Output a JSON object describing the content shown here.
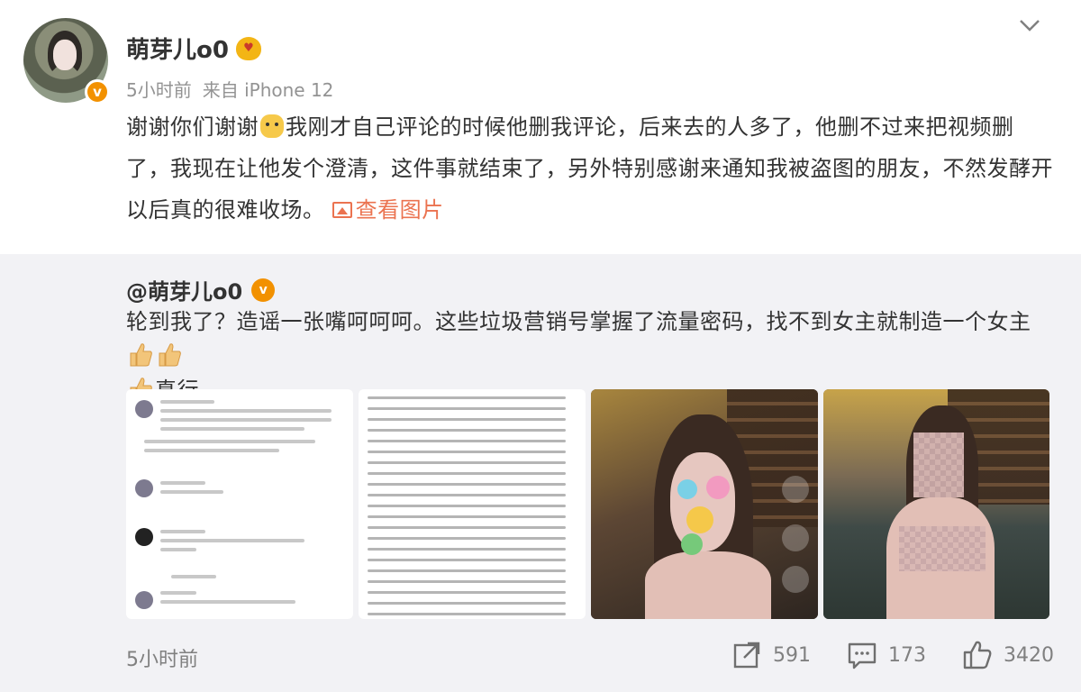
{
  "author": {
    "name": "萌芽儿o0",
    "level_badge_icon": "heart-face-badge-icon",
    "verified_icon": "verified-v-icon"
  },
  "meta": {
    "time": "5小时前",
    "source": "来自 iPhone 12"
  },
  "post": {
    "text_part1": "谢谢你们谢谢",
    "emoji": "dog-face-emoji-icon",
    "text_part2": "我刚才自己评论的时候他删我评论，后来去的人多了，他删不过来把视频删了，我现在让他发个澄清，这件事就结束了，另外特别感谢来通知我被盗图的朋友，不然发酵开以后真的很难收场。",
    "view_images_label": "查看图片"
  },
  "repost": {
    "author": "@萌芽儿o0",
    "text_part1": "轮到我了？造谣一张嘴呵呵呵。这些垃圾营销号掌握了流量密码，找不到女主就制造一个女主",
    "text_part2": "真行。",
    "thumb_icon": "thumbs-up-emoji-icon"
  },
  "footer": {
    "time": "5小时前",
    "repost_count": "591",
    "comment_count": "173",
    "like_count": "3420"
  },
  "colors": {
    "link": "#eb7350",
    "verified": "#f29100",
    "repost_bg": "#f2f2f5",
    "muted": "#939393"
  }
}
